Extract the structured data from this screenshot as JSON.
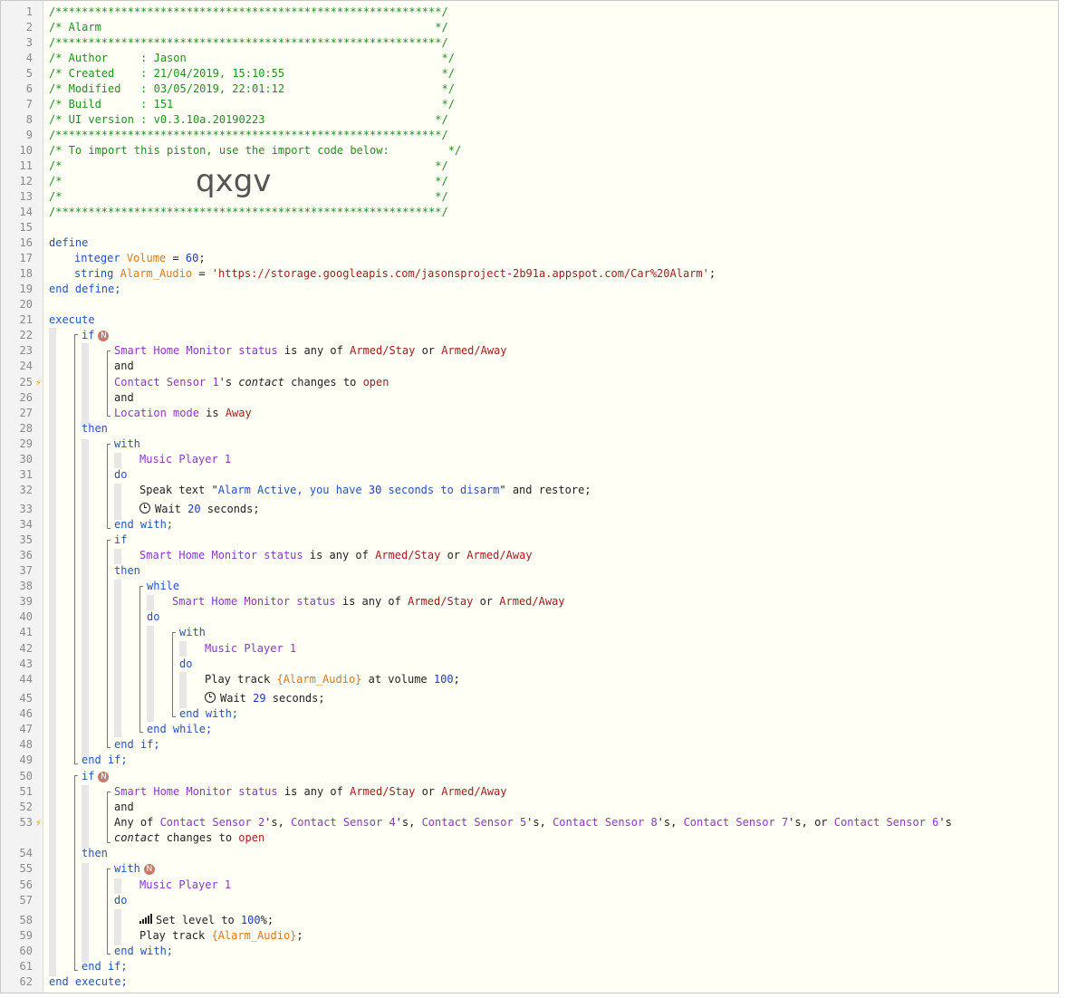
{
  "line_numbers": [
    "1",
    "2",
    "3",
    "4",
    "5",
    "6",
    "7",
    "8",
    "9",
    "10",
    "11",
    "12",
    "13",
    "14",
    "15",
    "16",
    "17",
    "18",
    "19",
    "20",
    "21",
    "22",
    "23",
    "24",
    "25",
    "26",
    "27",
    "28",
    "29",
    "30",
    "31",
    "32",
    "33",
    "34",
    "35",
    "36",
    "37",
    "38",
    "39",
    "40",
    "41",
    "42",
    "43",
    "44",
    "45",
    "46",
    "47",
    "48",
    "49",
    "50",
    "51",
    "52",
    "53",
    "54",
    "55",
    "56",
    "57",
    "58",
    "59",
    "60",
    "61",
    "62"
  ],
  "header": {
    "border": "/***********************************************************/",
    "title": "/* Alarm                                                   */",
    "author": "/* Author     : Jason                                       */",
    "created": "/* Created    : 21/04/2019, 15:10:55                        */",
    "modified": "/* Modified   : 03/05/2019, 22:01:12                        */",
    "build": "/* Build      : 151                                         */",
    "ui_version": "/* UI version : v0.3.10a.20190223                          */",
    "import_hint": "/* To import this piston, use the import code below:         */",
    "blank": "/*                                                         */",
    "import_code": "qxgv"
  },
  "define": {
    "open": "define",
    "close": "end define;",
    "vars": [
      {
        "type": "integer",
        "name": "Volume",
        "eq": " = ",
        "value": "60",
        "end": ";"
      },
      {
        "type": "string",
        "name": "Alarm_Audio",
        "eq": " = ",
        "value": "'https://storage.googleapis.com/jasonsproject-2b91a.appspot.com/Car%20Alarm'",
        "end": ";"
      }
    ]
  },
  "kw": {
    "execute": "execute",
    "end_execute": "end execute;",
    "if": "if",
    "then": "then",
    "and": "and",
    "with": "with",
    "do": "do",
    "end_with": "end with;",
    "end_if": "end if;",
    "while": "while",
    "end_while": "end while;",
    "badge": "N"
  },
  "tokens": {
    "shm_status": "Smart Home Monitor status",
    "is_any_of": " is any of ",
    "armed_stay": "Armed/Stay",
    "or": " or ",
    "armed_away": "Armed/Away",
    "contact_sensor_1": "Contact Sensor 1",
    "s": "'s ",
    "contact": "contact",
    "changes_to": " changes to ",
    "open": "open",
    "location_mode": "Location mode",
    "is": " is ",
    "away": "Away",
    "music_player_1": "Music Player 1",
    "speak_text": "Speak text \"",
    "speak_msg_a": "Alarm Active, you have ",
    "speak_num": "30",
    "speak_msg_b": " seconds to disarm",
    "speak_end": "\" and restore;",
    "wait": "Wait ",
    "wait_20": "20",
    "wait_29": "29",
    "seconds": " seconds;",
    "play_track": "Play track ",
    "alarm_audio_var": "{Alarm_Audio}",
    "at_volume": " at volume ",
    "vol_100": "100",
    "semi": ";",
    "any_of": "Any of ",
    "cs2": "Contact Sensor 2",
    "cs4": "Contact Sensor 4",
    "cs5": "Contact Sensor 5",
    "cs8": "Contact Sensor 8",
    "cs7": "Contact Sensor 7",
    "cs6": "Contact Sensor 6",
    "s_comma": "'s, ",
    "s_comma_or": "'s, or ",
    "s_end": "'s",
    "set_level": "Set level to ",
    "pct": "100",
    "pct_end": "%;"
  }
}
